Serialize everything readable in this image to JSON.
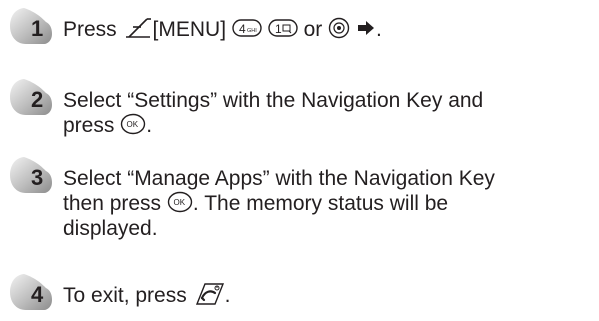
{
  "steps": [
    {
      "number": "1",
      "segments": [
        "Press",
        "[MENU]",
        "or",
        "."
      ]
    },
    {
      "number": "2",
      "lines": [
        "Select “Settings” with the Navigation Key and",
        "press",
        "."
      ]
    },
    {
      "number": "3",
      "lines": [
        "Select “Manage Apps” with the Navigation Key",
        "then press",
        ". The memory status will be",
        "displayed."
      ]
    },
    {
      "number": "4",
      "segments": [
        "To exit, press",
        "."
      ]
    }
  ],
  "key_labels": {
    "four": "4",
    "four_sub": "GHI",
    "one": "1",
    "ok": "OK"
  },
  "icons": {
    "step_badge": "step-number-badge",
    "menu_key": "menu-softkey-icon",
    "key_4": "keypad-4-icon",
    "key_1": "keypad-1-icon",
    "nav_key": "navigation-key-icon",
    "right_arrow": "right-arrow-icon",
    "ok_key": "ok-key-icon",
    "end_key": "end-power-key-icon"
  }
}
